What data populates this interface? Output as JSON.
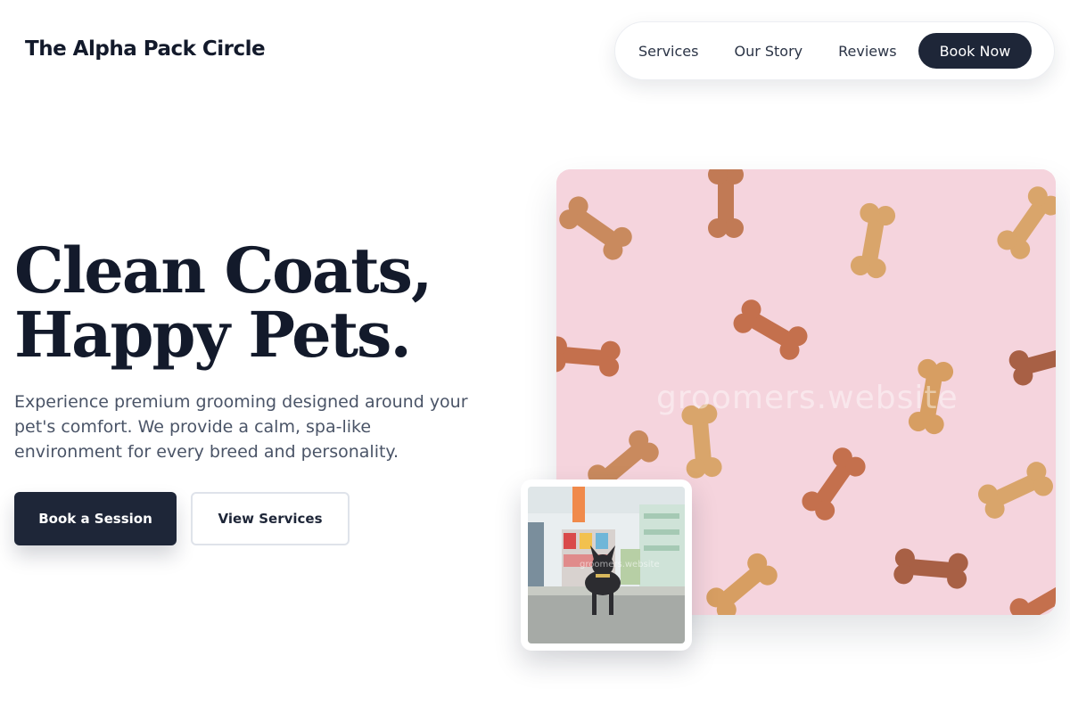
{
  "header": {
    "brand": "The Alpha Pack Circle",
    "nav": [
      "Services",
      "Our Story",
      "Reviews"
    ],
    "cta": "Book Now"
  },
  "hero": {
    "title_line1": "Clean Coats,",
    "title_line2": "Happy Pets.",
    "subtitle": "Experience premium grooming designed around your pet's comfort. We provide a calm, spa-like environment for every breed and personality.",
    "primary_button": "Book a Session",
    "secondary_button": "View Services"
  },
  "images": {
    "main_watermark": "groomers.website",
    "small_watermark": "groomers.website"
  },
  "colors": {
    "dark": "#1e2638",
    "text_muted": "#4a5467",
    "pink_bg": "#f5d4dd"
  }
}
